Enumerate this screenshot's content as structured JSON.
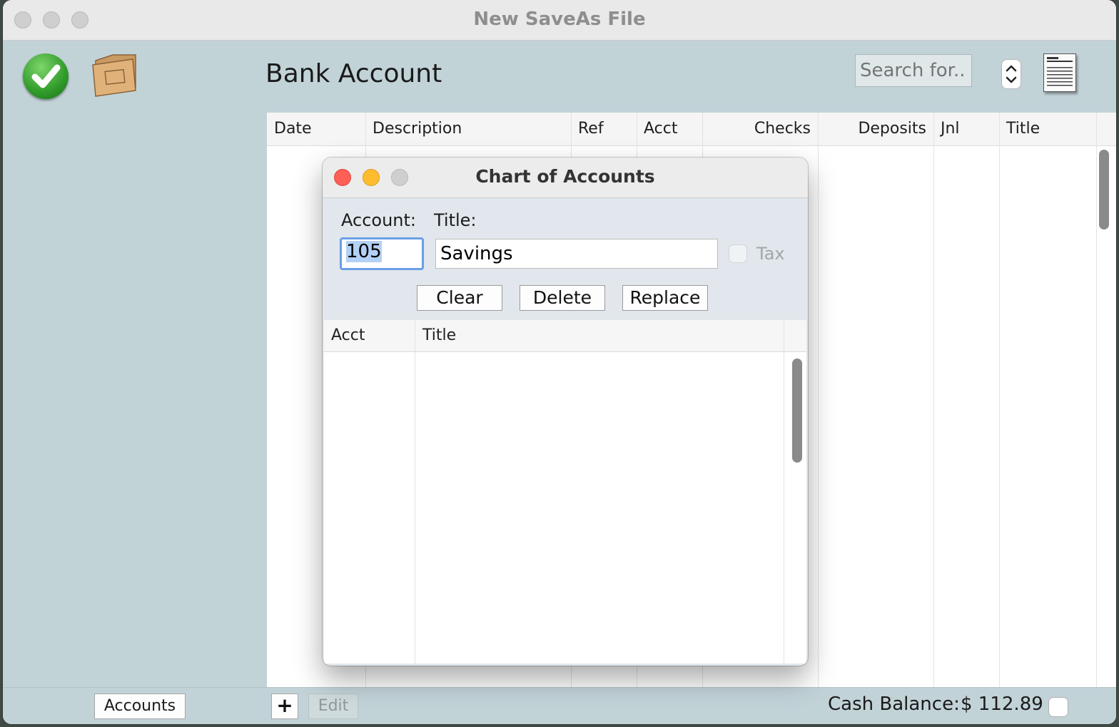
{
  "window": {
    "title": "New SaveAs File"
  },
  "toolbar": {
    "page_title": "Bank Account",
    "search_placeholder": "Search for..."
  },
  "register": {
    "columns": [
      "Date",
      "Description",
      "Ref",
      "Acct",
      "Checks",
      "Deposits",
      "Jnl",
      "Title"
    ],
    "rows": []
  },
  "bottom": {
    "accounts_label": "Accounts",
    "add_label": "+",
    "edit_label": "Edit",
    "cash_label": "Cash Balance:",
    "cash_value": "$ 112.89"
  },
  "dialog": {
    "title": "Chart of Accounts",
    "account_label": "Account:",
    "title_label": "Title:",
    "account_value": "105",
    "title_value": "Savings",
    "tax_label": "Tax",
    "tax_checked": false,
    "buttons": {
      "clear": "Clear",
      "delete": "Delete",
      "replace": "Replace"
    },
    "list_columns": [
      "Acct",
      "Title"
    ],
    "list_rows": []
  },
  "colors": {
    "window_bg": "#c2d3d8",
    "close_red": "#fe5f57",
    "minimize_yellow": "#febc2e",
    "focus_blue": "#6a9ee8"
  },
  "icons": [
    "checkmark-icon",
    "folder-icon",
    "stepper-icon",
    "document-icon"
  ]
}
